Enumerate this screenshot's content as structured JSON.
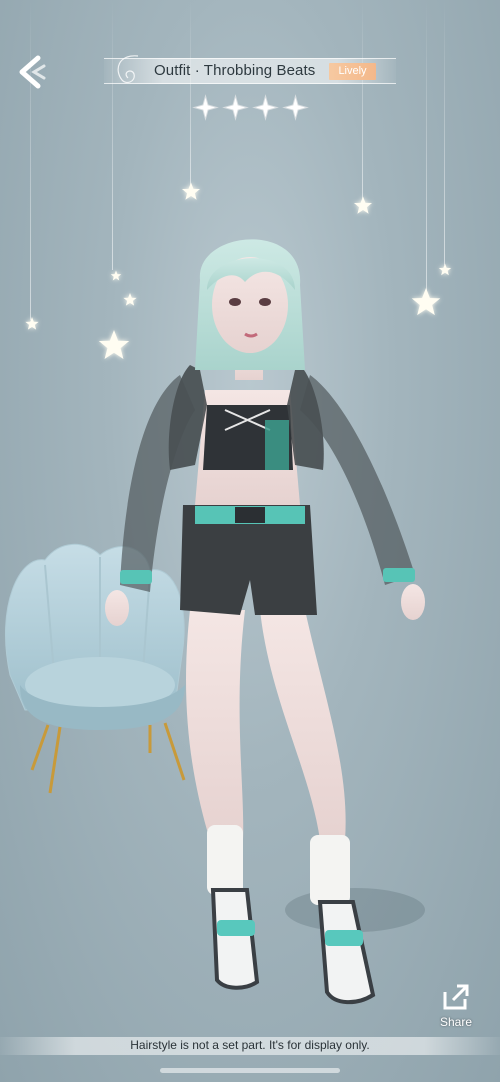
{
  "header": {
    "title": "Outfit · Throbbing Beats",
    "style_tag": "Lively",
    "rating_stars": 4
  },
  "icons": {
    "back": "back-arrow-icon",
    "share": "share-icon",
    "star": "star-icon"
  },
  "actions": {
    "share_label": "Share"
  },
  "footer": {
    "notice": "Hairstyle is not a set part. It's for display only."
  },
  "colors": {
    "background": "#a3b5bd",
    "tag_background": "#f4b88a",
    "accent_teal": "#3fc2b0"
  }
}
